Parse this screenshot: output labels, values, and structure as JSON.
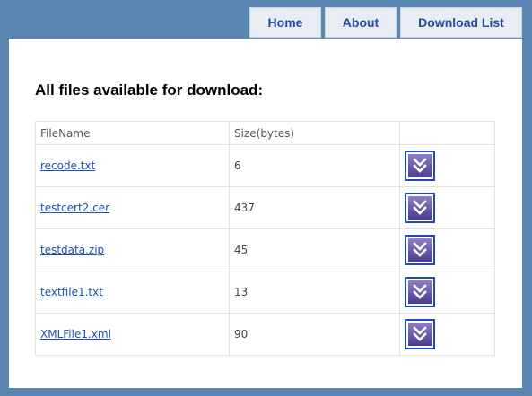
{
  "nav": {
    "tabs": [
      {
        "label": "Home"
      },
      {
        "label": "About"
      },
      {
        "label": "Download List"
      }
    ]
  },
  "main": {
    "heading": "All files available for download:",
    "table": {
      "columns": [
        "FileName",
        "Size(bytes)",
        ""
      ],
      "rows": [
        {
          "name": "recode.txt",
          "size": "6"
        },
        {
          "name": "testcert2.cer",
          "size": "437"
        },
        {
          "name": "testdata.zip",
          "size": "45"
        },
        {
          "name": "textfile1.txt",
          "size": "13"
        },
        {
          "name": "XMLFile1.xml",
          "size": "90"
        }
      ],
      "download_icon": "double-chevron-down-icon"
    }
  },
  "colors": {
    "background": "#5b86b2",
    "panel": "#ffffff",
    "nav_tab": "#e8edf3",
    "link": "#1d4fb8",
    "download_button_border": "#1f4ab0",
    "download_button_fill": "#5a4aa3"
  }
}
